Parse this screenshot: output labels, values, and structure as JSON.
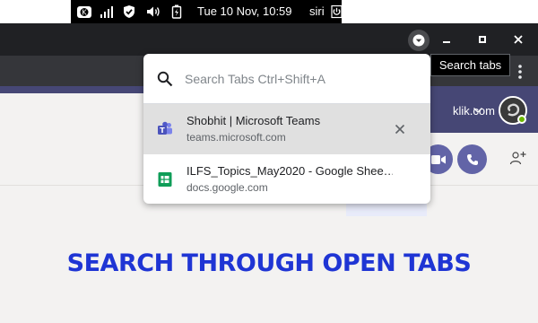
{
  "os_bar": {
    "clock": "Tue 10 Nov, 10:59",
    "user": "siri",
    "icons": [
      "kde-connect-icon",
      "network-signal-icon",
      "security-shield-icon",
      "volume-icon",
      "battery-icon",
      "power-icon"
    ]
  },
  "browser": {
    "tooltip": "Search tabs",
    "window_buttons": [
      "minimize-icon",
      "maximize-icon",
      "close-icon"
    ]
  },
  "tab_search": {
    "placeholder": "Search Tabs Ctrl+Shift+A",
    "value": "",
    "tabs": [
      {
        "title": "Shobhit | Microsoft Teams",
        "host": "teams.microsoft.com",
        "favicon": "teams-icon",
        "selected": true,
        "color": "#5059c9"
      },
      {
        "title": "ILFS_Topics_May2020 - Google Shee…",
        "host": "docs.google.com",
        "favicon": "sheets-icon",
        "selected": false,
        "color": "#0f9d58"
      }
    ]
  },
  "teams": {
    "account_text": "klik.com",
    "accent": "#6264a7",
    "header_color": "#464775"
  },
  "headline": {
    "text": "SEARCH THROUGH OPEN TABS",
    "color": "#1f35d4"
  }
}
